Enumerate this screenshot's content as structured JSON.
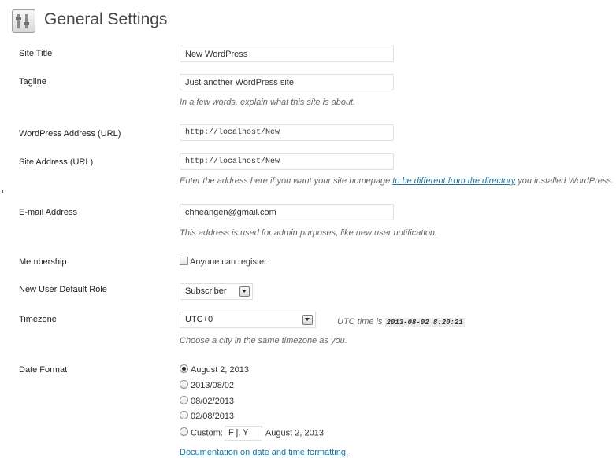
{
  "header": {
    "title": "General Settings",
    "icon": "settings-tools-icon"
  },
  "fields": {
    "site_title": {
      "label": "Site Title",
      "value": "New WordPress"
    },
    "tagline": {
      "label": "Tagline",
      "value": "Just another WordPress site",
      "description": "In a few words, explain what this site is about."
    },
    "wp_address": {
      "label": "WordPress Address (URL)",
      "value": "http://localhost/New"
    },
    "site_address": {
      "label": "Site Address (URL)",
      "value": "http://localhost/New",
      "description_before": "Enter the address here if you want your site homepage ",
      "description_link": "to be different from the directory",
      "description_after": " you installed WordPress."
    },
    "email": {
      "label": "E-mail Address",
      "value": "chheangen@gmail.com",
      "description": "This address is used for admin purposes, like new user notification."
    },
    "membership": {
      "label": "Membership",
      "checkbox_label": "Anyone can register",
      "checked": false
    },
    "default_role": {
      "label": "New User Default Role",
      "value": "Subscriber"
    },
    "timezone": {
      "label": "Timezone",
      "value": "UTC+0",
      "utc_label": "UTC time is",
      "utc_value": "2013-08-02 8:20:21",
      "description": "Choose a city in the same timezone as you."
    },
    "date_format": {
      "label": "Date Format",
      "options": [
        "August 2, 2013",
        "2013/08/02",
        "08/02/2013",
        "02/08/2013"
      ],
      "selected_index": 0,
      "custom_label": "Custom:",
      "custom_value": "F j, Y",
      "custom_preview": "August 2, 2013",
      "doc_link": "Documentation on date and time formatting",
      "doc_link_suffix": "."
    }
  },
  "colors": {
    "link": "#21759b",
    "label": "#222222",
    "description": "#666666"
  }
}
